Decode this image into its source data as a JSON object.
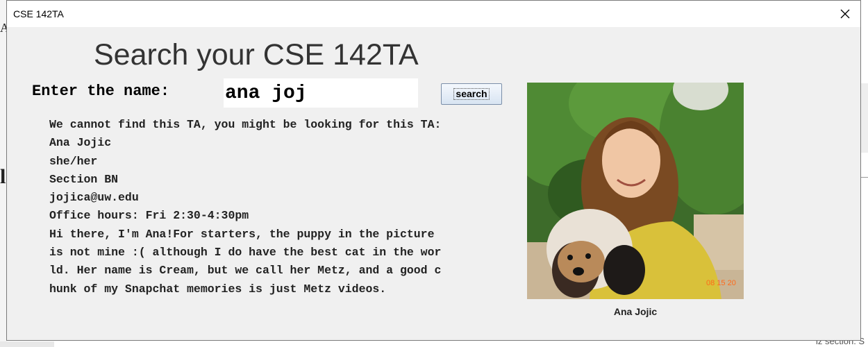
{
  "window": {
    "title": "CSE 142TA"
  },
  "heading": "Search your CSE 142TA",
  "search": {
    "label": "Enter the name:",
    "value": "ana joj",
    "button_label": "search"
  },
  "result": {
    "lines": [
      "We cannot find this TA, you might be looking for this TA:",
      "Ana Jojic",
      "she/her",
      "Section BN",
      "jojica@uw.edu",
      "Office hours: Fri 2:30-4:30pm",
      "Hi there, I'm Ana!For starters, the puppy in the picture",
      "is not mine :( although I do have the best cat in the wor",
      "ld. Her name is Cream, but we call her Metz, and a good c",
      "hunk of my Snapchat memories is just Metz videos."
    ]
  },
  "photo": {
    "caption": "Ana Jojic",
    "timestamp": "08 15 20"
  },
  "background": {
    "bottom_right_text": "iz section. S"
  }
}
